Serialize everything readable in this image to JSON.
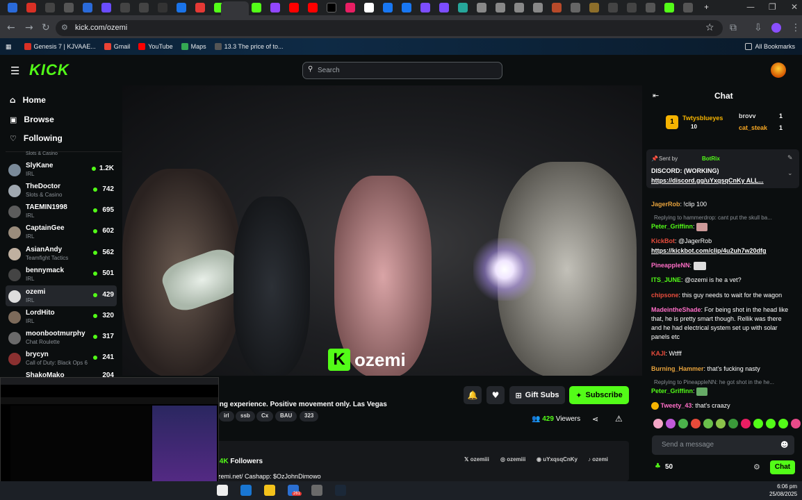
{
  "browser": {
    "url": "kick.com/ozemi",
    "bookmarks": [
      {
        "label": "Genesis 7 | KJVAAE...",
        "color": "#d93025"
      },
      {
        "label": "Gmail",
        "color": "#ea4335"
      },
      {
        "label": "YouTube",
        "color": "#ff0000"
      },
      {
        "label": "Maps",
        "color": "#34a853"
      },
      {
        "label": "13.3 The price of to...",
        "color": "#555"
      }
    ],
    "all_bookmarks": "All Bookmarks"
  },
  "kick": {
    "logo": "KICK",
    "search_placeholder": "Search",
    "accent": "#53fc18"
  },
  "sidebar": {
    "nav": [
      {
        "label": "Home",
        "icon": "home-icon"
      },
      {
        "label": "Browse",
        "icon": "browse-icon"
      },
      {
        "label": "Following",
        "icon": "heart-icon"
      }
    ],
    "partial_category": "Slots & Casino",
    "channels": [
      {
        "name": "SlyKane",
        "category": "IRL",
        "viewers": "1.2K"
      },
      {
        "name": "TheDoctor",
        "category": "Slots & Casino",
        "viewers": "742"
      },
      {
        "name": "TAEMIN1998",
        "category": "IRL",
        "viewers": "695"
      },
      {
        "name": "CaptainGee",
        "category": "IRL",
        "viewers": "602"
      },
      {
        "name": "AsianAndy",
        "category": "Teamfight Tactics",
        "viewers": "562"
      },
      {
        "name": "bennymack",
        "category": "IRL",
        "viewers": "501"
      },
      {
        "name": "ozemi",
        "category": "IRL",
        "viewers": "429"
      },
      {
        "name": "LordHito",
        "category": "IRL",
        "viewers": "320"
      },
      {
        "name": "moonbootmurphy",
        "category": "Chat Roulette",
        "viewers": "317"
      },
      {
        "name": "brycyn",
        "category": "Call of Duty: Black Ops 6",
        "viewers": "241"
      },
      {
        "name": "ShakoMako",
        "category": "",
        "viewers": "204"
      }
    ]
  },
  "stream": {
    "watermark": "ozemi",
    "title": "ing experience. Positive movement only. Las Vegas",
    "tags": [
      "irl",
      "ssb",
      "Cx",
      "BAU",
      "323"
    ],
    "gift_subs": "Gift Subs",
    "subscribe": "Subscribe",
    "viewers_count": "429",
    "viewers_label": "Viewers",
    "followers_count": ".4K",
    "followers_label": "Followers",
    "socials": [
      "ozemiii",
      "ozemiii",
      "uYxqsqCnKy",
      "ozemi"
    ],
    "bio": "zemi.net/ Cashapp: $OzJohnDimowo"
  },
  "chat": {
    "title": "Chat",
    "leaderboard": [
      {
        "rank": "1",
        "name": "Twtysblueyes",
        "value": "10"
      },
      {
        "name": "brovv",
        "value": "1"
      },
      {
        "name": "cat_steak",
        "value": "1"
      }
    ],
    "pinned": {
      "sent_by": "Sent by",
      "sender": "BotRix",
      "text": "DISCORD: (WORKING)",
      "link": "https://discord.gg/uYxqsqCnKy ALL..."
    },
    "messages": [
      {
        "user": "JagerRob",
        "color": "#e6a23c",
        "text": ": !clip 100"
      },
      {
        "reply": "Replying to hammerdrop: cant put the skull ba..."
      },
      {
        "user": "Peter_Griffinn",
        "color": "#53fc18",
        "text": ":"
      },
      {
        "user": "KickBot",
        "color": "#e74c3c",
        "text": ": @JagerRob"
      },
      {
        "link": "https://kickbot.com/clip/4u2uh7w20dfg"
      },
      {
        "user": "PineappleNN",
        "color": "#ff6ec7",
        "text": ":"
      },
      {
        "user": "ITS_JUNE",
        "color": "#53fc18",
        "text": ": @ozemi is he a vet?"
      },
      {
        "user": "chipsone",
        "color": "#e74c3c",
        "text": ": this guy needs to wait for the wagon"
      },
      {
        "user": "MadeintheShade",
        "color": "#ff6ec7",
        "text": ": For being shot in the head like that, he is pretty smart though. Rellik was there and he had electrical system set up with solar panels etc"
      },
      {
        "user": "KAJI",
        "color": "#e74c3c",
        "text": ": Wtfff"
      },
      {
        "user": "Burning_Hammer",
        "color": "#e6a23c",
        "text": ": that's fucking nasty"
      },
      {
        "reply": "Replying to PineappleNN: he got shot in the he..."
      },
      {
        "user": "Peter_Griffinn",
        "color": "#53fc18",
        "text": ":"
      },
      {
        "user": "Tweety_43",
        "color": "#ff6ec7",
        "text": ": that's craazy"
      }
    ],
    "send_placeholder": "Send a message",
    "points": "50",
    "chat_button": "Chat"
  },
  "taskbar": {
    "time": "6:06 pm",
    "date": "25/08/2025",
    "badge": "261"
  }
}
